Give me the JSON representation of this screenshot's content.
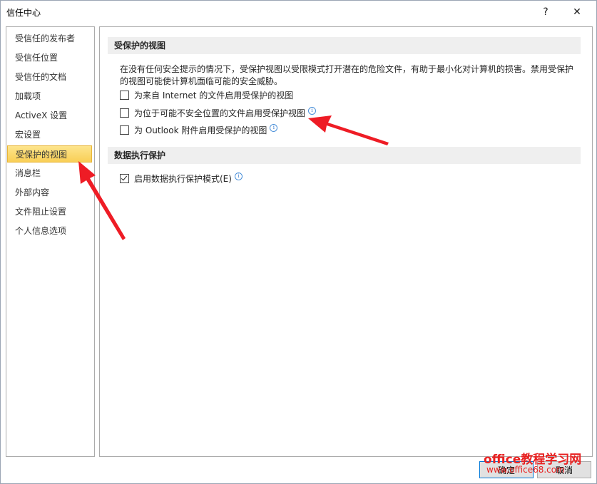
{
  "window": {
    "title": "信任中心",
    "help": "?",
    "close": "✕"
  },
  "sidebar": {
    "items": [
      {
        "label": "受信任的发布者"
      },
      {
        "label": "受信任位置"
      },
      {
        "label": "受信任的文档"
      },
      {
        "label": "加载项"
      },
      {
        "label": "ActiveX 设置"
      },
      {
        "label": "宏设置"
      },
      {
        "label": "受保护的视图"
      },
      {
        "label": "消息栏"
      },
      {
        "label": "外部内容"
      },
      {
        "label": "文件阻止设置"
      },
      {
        "label": "个人信息选项"
      }
    ],
    "selected": "受保护的视图"
  },
  "protected_view": {
    "heading": "受保护的视图",
    "description": "在没有任何安全提示的情况下，受保护视图以受限模式打开潜在的危险文件，有助于最小化对计算机的损害。禁用受保护的视图可能使计算机面临可能的安全威胁。",
    "options": [
      {
        "label": "为来自 Internet 的文件启用受保护的视图",
        "checked": false
      },
      {
        "label": "为位于可能不安全位置的文件启用受保护视图",
        "checked": false
      },
      {
        "label": "为 Outlook 附件启用受保护的视图",
        "checked": false
      }
    ]
  },
  "dep": {
    "heading": "数据执行保护",
    "option": {
      "label": "启用数据执行保护模式(E)",
      "checked": true
    }
  },
  "footer": {
    "ok": "确定",
    "cancel": "取消"
  },
  "watermark": {
    "line1": "office教程学习网",
    "line2": "www.office68.com"
  },
  "colors": {
    "selected_bg": "#fbd96d",
    "arrow": "#ee1c25",
    "section_bg": "#efefef"
  }
}
